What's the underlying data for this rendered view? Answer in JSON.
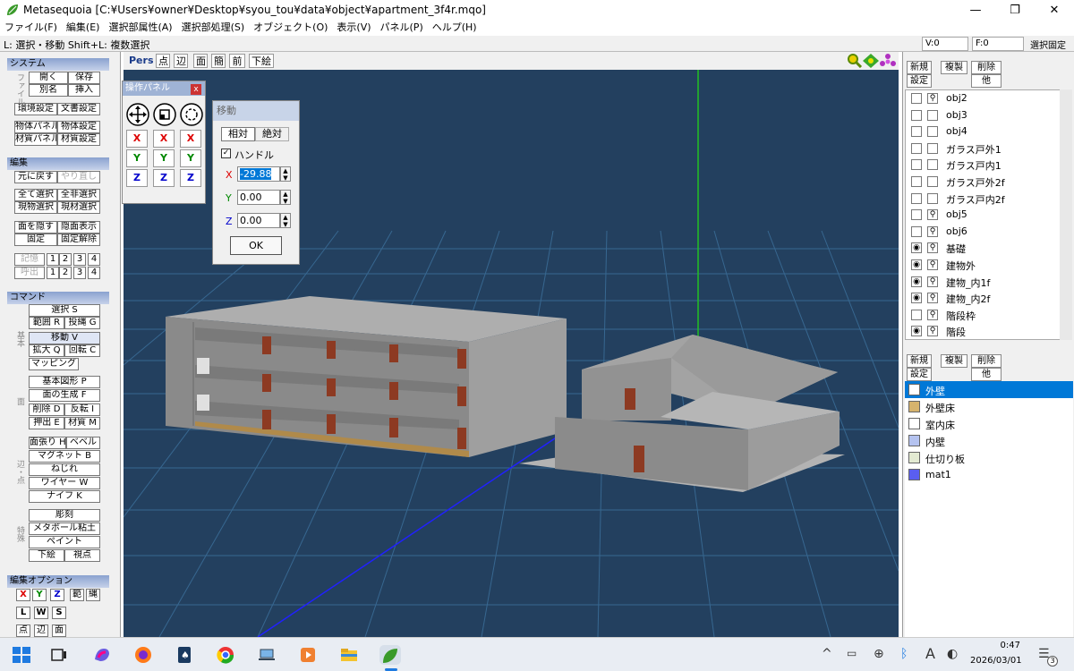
{
  "window": {
    "title": "Metasequoia [C:¥Users¥owner¥Desktop¥syou_tou¥data¥object¥apartment_3f4r.mqo]",
    "min": "—",
    "max": "❐",
    "close": "✕"
  },
  "menu": [
    "ファイル(F)",
    "編集(E)",
    "選択部属性(A)",
    "選択部処理(S)",
    "オブジェクト(O)",
    "表示(V)",
    "パネル(P)",
    "ヘルプ(H)"
  ],
  "hint": "L: 選択・移動  Shift+L: 複数選択",
  "status": {
    "v": "V:0",
    "f": "F:0",
    "fixed": "選択固定"
  },
  "left": {
    "system": {
      "title": "システム",
      "side_file": "ファイル",
      "open": "開く",
      "save": "保存",
      "saveas": "別名",
      "insert": "挿入",
      "env": "環境設定",
      "doc": "文書設定",
      "obj_panel": "物体パネル",
      "obj_set": "物体設定",
      "mat_panel": "材質パネル",
      "mat_set": "材質設定"
    },
    "edit": {
      "title": "編集",
      "undo": "元に戻す",
      "redo": "やり直し",
      "selall": "全て選択",
      "deselall": "全非選択",
      "cur_obj": "現物選択",
      "cur_mat": "現材選択",
      "hide": "面を隠す",
      "showhidden": "隠面表示",
      "fix": "固定",
      "unfix": "固定解除",
      "memory": "記憶",
      "recall": "呼出",
      "n1": "1",
      "n2": "2",
      "n3": "3",
      "n4": "4"
    },
    "command": {
      "title": "コマンド",
      "select": "選択 S",
      "range": "範囲 R",
      "lasso": "投縄 G",
      "move": "移動 V",
      "scale": "拡大 Q",
      "rotate": "回転 C",
      "mapping": "マッピング",
      "side_basic": "基本",
      "prim": "基本図形 P",
      "face": "面の生成 F",
      "delete": "削除 D",
      "flip": "反転 I",
      "extrude": "押出 E",
      "material": "材質 M",
      "side_face": "面",
      "knife_face": "面張り H",
      "bevel": "ベベル",
      "magnet": "マグネット B",
      "twist": "ねじれ",
      "wire": "ワイヤー W",
      "knife": "ナイフ K",
      "side_edge": "辺・点",
      "sculpt": "彫刻",
      "metaball": "メタボール粘土",
      "paint": "ペイント",
      "underlay": "下絵",
      "viewpoint": "視点",
      "side_special": "特殊"
    },
    "options": {
      "title": "編集オプション",
      "x": "X",
      "y": "Y",
      "z": "Z",
      "range": "範",
      "lasso": "縄",
      "l": "L",
      "w": "W",
      "s": "S",
      "pt": "点",
      "edge": "辺",
      "face": "面"
    }
  },
  "viewtool": {
    "pers": "Pers",
    "pt": "点",
    "edge": "辺",
    "face": "面",
    "simple": "簡",
    "front": "前",
    "underlay": "下絵",
    "icons": [
      "zoom-icon",
      "pan-icon",
      "rotate-view-icon"
    ]
  },
  "oppanel": {
    "title": "操作パネル",
    "close": "x",
    "x": "X",
    "y": "Y",
    "z": "Z"
  },
  "move": {
    "title": "移動",
    "relative": "相対",
    "absolute": "絶対",
    "handle": "ハンドル",
    "x_label": "X",
    "y_label": "Y",
    "z_label": "Z",
    "x": "-29.88",
    "y": "0.00",
    "z": "0.00",
    "ok": "OK"
  },
  "objects": {
    "new": "新規",
    "dup": "複製",
    "del": "削除",
    "set": "設定",
    "other": "他",
    "items": [
      {
        "name": "obj2",
        "vis": false,
        "lock": true
      },
      {
        "name": "obj3",
        "vis": false,
        "lock": false
      },
      {
        "name": "obj4",
        "vis": false,
        "lock": false
      },
      {
        "name": "ガラス戸外1",
        "vis": false,
        "lock": false
      },
      {
        "name": "ガラス戸内1",
        "vis": false,
        "lock": false
      },
      {
        "name": "ガラス戸外2f",
        "vis": false,
        "lock": false
      },
      {
        "name": "ガラス戸内2f",
        "vis": false,
        "lock": false
      },
      {
        "name": "obj5",
        "vis": false,
        "lock": true
      },
      {
        "name": "obj6",
        "vis": false,
        "lock": true
      },
      {
        "name": "基礎",
        "vis": true,
        "lock": true
      },
      {
        "name": "建物外",
        "vis": true,
        "lock": true
      },
      {
        "name": "建物_内1f",
        "vis": true,
        "lock": true
      },
      {
        "name": "建物_内2f",
        "vis": true,
        "lock": true
      },
      {
        "name": "階段枠",
        "vis": false,
        "lock": true
      },
      {
        "name": "階段",
        "vis": true,
        "lock": true
      }
    ]
  },
  "materials": {
    "new": "新規",
    "dup": "複製",
    "del": "削除",
    "set": "設定",
    "other": "他",
    "items": [
      {
        "name": "外壁",
        "color": "#ffffff",
        "selected": true
      },
      {
        "name": "外壁床",
        "color": "#d6b36d"
      },
      {
        "name": "室内床",
        "color": "#ffffff"
      },
      {
        "name": "内壁",
        "color": "#b5c3f0"
      },
      {
        "name": "仕切り板",
        "color": "#e3ead2"
      },
      {
        "name": "mat1",
        "color": "#5a5ef0"
      }
    ]
  },
  "taskbar": {
    "time": "0:47",
    "date": "2026/03/01",
    "ime": "A",
    "notify": "3",
    "icons": [
      "windows-start-icon",
      "task-view-icon",
      "copilot-icon",
      "firefox-icon",
      "solitaire-icon",
      "chrome-icon",
      "laptop-icon",
      "media-player-icon",
      "file-explorer-icon",
      "metasequoia-icon"
    ]
  },
  "colors": {
    "viewport": "#23405f",
    "section": "#8aa2cf",
    "select": "#0078d7"
  }
}
